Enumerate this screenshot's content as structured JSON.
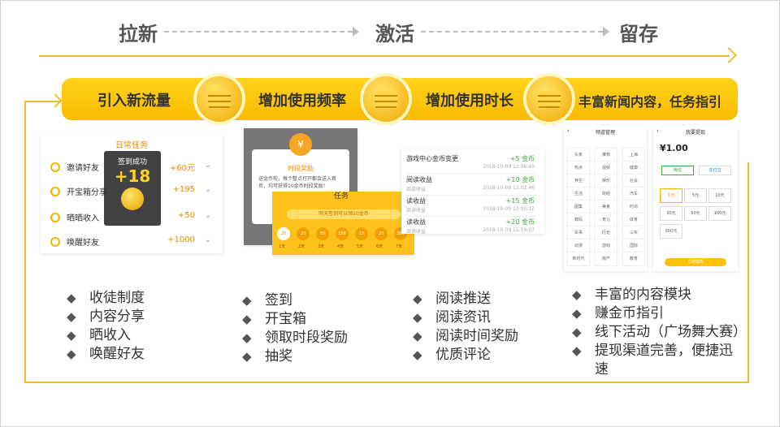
{
  "stages": [
    "拉新",
    "激活",
    "留存"
  ],
  "phases": [
    "引入新流量",
    "增加使用频率",
    "增加使用时长",
    "丰富新闻内容，任务指引"
  ],
  "columns": [
    {
      "bullets": [
        "收徒制度",
        "内容分享",
        "晒收入",
        "唤醒好友"
      ]
    },
    {
      "bullets": [
        "签到",
        "开宝箱",
        "领取时段奖励",
        "抽奖"
      ]
    },
    {
      "bullets": [
        "阅读推送",
        "阅读资讯",
        "阅读时间奖励",
        "优质评论"
      ]
    },
    {
      "bullets": [
        "丰富的内容模块",
        "赚金币指引",
        "线下活动（广场舞大赛）",
        "提现渠道完善，便捷迅速"
      ]
    }
  ],
  "shot1": {
    "title": "日常任务",
    "popup_title": "签到成功",
    "popup_value": "+18",
    "tasks": [
      {
        "name": "邀请好友",
        "reward": "+60元"
      },
      {
        "name": "开宝箱分享",
        "reward": "+195"
      },
      {
        "name": "晒晒收入",
        "reward": "+50"
      },
      {
        "name": "唤醒好友",
        "reward": "+1000"
      }
    ]
  },
  "shot2": {
    "popup_title": "时段奖励",
    "popup_text": "送金币啦，每个整点打开都会送入首页，均可获得10金币时段奖励！",
    "task_title": "任务",
    "banner": "明天签到可以领20金币",
    "coins": [
      "20",
      "20",
      "55",
      "158",
      "15",
      "20",
      "388"
    ],
    "days": [
      "1天",
      "2天",
      "3天",
      "4天",
      "5天",
      "6天",
      "7天"
    ]
  },
  "shot3": {
    "rows": [
      {
        "name": "游戏中心金币变更",
        "sub": "",
        "amount": "+5 金币",
        "time": "2018-10-09 12:06:49"
      },
      {
        "name": "阅读收益",
        "sub": "阅读收益",
        "amount": "+10 金币",
        "time": "2018-10-09 12:02:46"
      },
      {
        "name": "读收益",
        "sub": "阅读收益",
        "amount": "+15 金币",
        "time": "2018-10-09 12:00:12"
      },
      {
        "name": "读收益",
        "sub": "阅读收益",
        "amount": "+20 金币",
        "time": "2018-10-09 11:59:07"
      }
    ]
  },
  "shot4": {
    "left_title": "频道管理",
    "right_title": "我要提现",
    "balance": "1.00",
    "method_wechat": "微信",
    "method_alipay": "支付宝",
    "amounts": [
      "1元",
      "5元",
      "10元",
      "30元",
      "50元",
      "100元",
      "500元"
    ],
    "button": "立即提现",
    "channels": [
      "头条",
      "推荐",
      "上海",
      "热点",
      "视频",
      "健康",
      "养生",
      "娱乐",
      "社会",
      "生活",
      "财经",
      "汽车",
      "图集",
      "美食",
      "时尚",
      "数码",
      "育儿",
      "体育",
      "军事",
      "历史",
      "三农",
      "动漫",
      "游戏",
      "国际",
      "新时代",
      "房产",
      "教育"
    ]
  }
}
